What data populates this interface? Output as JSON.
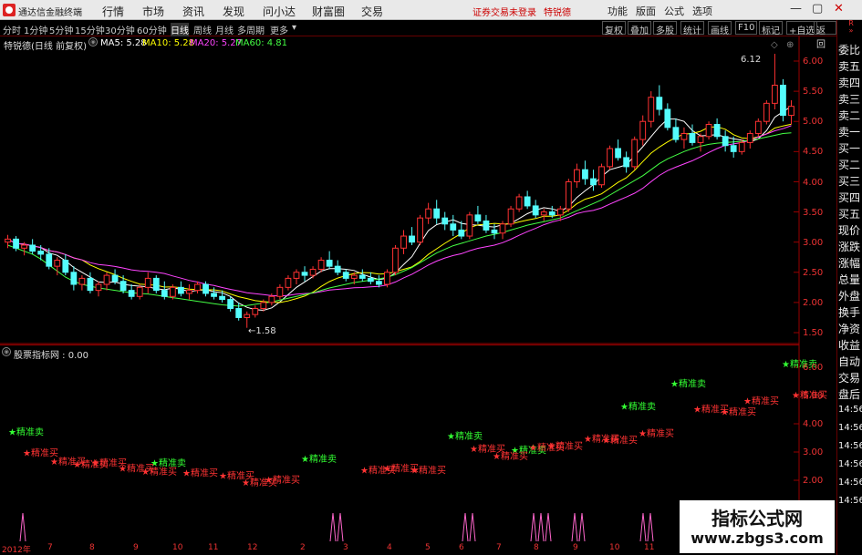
{
  "menubar": {
    "app_title": "通达信金融终端",
    "menus": [
      "行情",
      "市场",
      "资讯",
      "发现",
      "问小达",
      "财富圈",
      "交易"
    ],
    "notice_left": "证券交易未登录",
    "notice_right": "特锐德",
    "right_items": [
      "功能",
      "版面",
      "公式",
      "选项"
    ],
    "window_buttons": [
      "—",
      "▢",
      "✕"
    ]
  },
  "toolbar": {
    "periods": [
      "分时",
      "1分钟",
      "5分钟",
      "15分钟",
      "30分钟",
      "60分钟",
      "日线",
      "周线",
      "月线",
      "多周期",
      "更多"
    ],
    "selected_period": "日线",
    "right_buttons": [
      "复权",
      "叠加",
      "多股",
      "统计",
      "画线",
      "F10",
      "标记",
      "+自选",
      "返回"
    ]
  },
  "main_chart": {
    "legend_name": "特锐德(日线 前复权)",
    "ma": [
      {
        "label": "MA5: 5.28",
        "color": "#ffffff"
      },
      {
        "label": "MA10: 5.28",
        "color": "#ffff00"
      },
      {
        "label": "MA20: 5.27",
        "color": "#ff44ff"
      },
      {
        "label": "MA60: 4.81",
        "color": "#44ff44"
      }
    ],
    "max_label": "6.12",
    "min_label": "←1.58",
    "price_axis": [
      "6.00",
      "5.50",
      "5.00",
      "4.50",
      "4.00",
      "3.50",
      "3.00",
      "2.50",
      "2.00",
      "1.50"
    ]
  },
  "indicator": {
    "legend": "股票指标网 : 0.00",
    "axis": [
      "6.00",
      "5.00",
      "4.00",
      "3.00",
      "2.00"
    ],
    "sell_label": "精准卖",
    "buy_label": "精准买"
  },
  "date_axis": [
    "2012年",
    "7",
    "8",
    "9",
    "10",
    "11",
    "12",
    "2",
    "3",
    "4",
    "5",
    "6",
    "7",
    "8",
    "9",
    "10",
    "11",
    "12"
  ],
  "right_panel": [
    "委比",
    "卖五",
    "卖四",
    "卖三",
    "卖二",
    "卖一",
    "买一",
    "买二",
    "买三",
    "买四",
    "买五",
    "现价",
    "涨跌",
    "涨幅",
    "总量",
    "外盘",
    "换手",
    "净资",
    "收益",
    "自动",
    "交易",
    "盘后",
    "14:56",
    "14:56",
    "14:56",
    "14:56",
    "14:56",
    "14:56"
  ],
  "watermark": {
    "title": "指标公式网",
    "url": "www.zbgs3.com"
  },
  "chart_data": {
    "type": "candlestick",
    "candles": [
      [
        3.0,
        3.12,
        2.9,
        3.05
      ],
      [
        3.05,
        3.1,
        2.85,
        2.9
      ],
      [
        2.9,
        3.0,
        2.78,
        2.95
      ],
      [
        2.95,
        3.05,
        2.8,
        2.85
      ],
      [
        2.85,
        2.95,
        2.7,
        2.8
      ],
      [
        2.8,
        2.9,
        2.55,
        2.6
      ],
      [
        2.6,
        2.75,
        2.45,
        2.7
      ],
      [
        2.7,
        2.8,
        2.45,
        2.5
      ],
      [
        2.5,
        2.6,
        2.2,
        2.3
      ],
      [
        2.3,
        2.45,
        2.2,
        2.4
      ],
      [
        2.4,
        2.5,
        2.15,
        2.2
      ],
      [
        2.2,
        2.35,
        2.1,
        2.3
      ],
      [
        2.3,
        2.5,
        2.2,
        2.45
      ],
      [
        2.45,
        2.55,
        2.3,
        2.35
      ],
      [
        2.35,
        2.45,
        2.15,
        2.2
      ],
      [
        2.2,
        2.3,
        2.05,
        2.1
      ],
      [
        2.1,
        2.3,
        2.05,
        2.25
      ],
      [
        2.25,
        2.5,
        2.15,
        2.4
      ],
      [
        2.4,
        2.45,
        2.15,
        2.2
      ],
      [
        2.2,
        2.35,
        2.05,
        2.1
      ],
      [
        2.1,
        2.3,
        2.05,
        2.25
      ],
      [
        2.25,
        2.35,
        2.1,
        2.15
      ],
      [
        2.15,
        2.3,
        2.05,
        2.2
      ],
      [
        2.2,
        2.35,
        2.15,
        2.3
      ],
      [
        2.3,
        2.35,
        2.1,
        2.15
      ],
      [
        2.15,
        2.25,
        2.05,
        2.1
      ],
      [
        2.1,
        2.2,
        2.0,
        2.05
      ],
      [
        2.05,
        2.1,
        1.85,
        1.9
      ],
      [
        1.9,
        2.0,
        1.7,
        1.75
      ],
      [
        1.75,
        1.85,
        1.58,
        1.8
      ],
      [
        1.8,
        1.95,
        1.75,
        1.9
      ],
      [
        1.9,
        2.05,
        1.85,
        2.0
      ],
      [
        2.0,
        2.15,
        1.95,
        2.1
      ],
      [
        2.1,
        2.3,
        2.05,
        2.25
      ],
      [
        2.25,
        2.45,
        2.2,
        2.4
      ],
      [
        2.4,
        2.55,
        2.3,
        2.5
      ],
      [
        2.5,
        2.6,
        2.35,
        2.45
      ],
      [
        2.45,
        2.6,
        2.4,
        2.55
      ],
      [
        2.55,
        2.75,
        2.5,
        2.7
      ],
      [
        2.7,
        2.85,
        2.55,
        2.6
      ],
      [
        2.6,
        2.7,
        2.45,
        2.5
      ],
      [
        2.5,
        2.55,
        2.35,
        2.4
      ],
      [
        2.4,
        2.5,
        2.3,
        2.45
      ],
      [
        2.45,
        2.55,
        2.35,
        2.4
      ],
      [
        2.4,
        2.5,
        2.3,
        2.35
      ],
      [
        2.35,
        2.45,
        2.25,
        2.3
      ],
      [
        2.3,
        2.55,
        2.25,
        2.5
      ],
      [
        2.5,
        2.95,
        2.45,
        2.9
      ],
      [
        2.9,
        3.2,
        2.8,
        3.1
      ],
      [
        3.1,
        3.25,
        2.95,
        3.0
      ],
      [
        3.0,
        3.45,
        2.95,
        3.4
      ],
      [
        3.4,
        3.65,
        3.3,
        3.55
      ],
      [
        3.55,
        3.7,
        3.3,
        3.4
      ],
      [
        3.4,
        3.5,
        3.2,
        3.3
      ],
      [
        3.3,
        3.45,
        3.1,
        3.2
      ],
      [
        3.2,
        3.35,
        3.05,
        3.1
      ],
      [
        3.1,
        3.5,
        3.05,
        3.45
      ],
      [
        3.45,
        3.6,
        3.3,
        3.35
      ],
      [
        3.35,
        3.45,
        3.15,
        3.2
      ],
      [
        3.2,
        3.3,
        3.05,
        3.15
      ],
      [
        3.15,
        3.35,
        3.05,
        3.3
      ],
      [
        3.3,
        3.6,
        3.25,
        3.55
      ],
      [
        3.55,
        3.8,
        3.5,
        3.75
      ],
      [
        3.75,
        3.85,
        3.55,
        3.6
      ],
      [
        3.6,
        3.7,
        3.4,
        3.45
      ],
      [
        3.45,
        3.55,
        3.35,
        3.5
      ],
      [
        3.5,
        3.6,
        3.4,
        3.45
      ],
      [
        3.45,
        3.6,
        3.35,
        3.55
      ],
      [
        3.55,
        4.05,
        3.5,
        4.0
      ],
      [
        4.0,
        4.3,
        3.9,
        4.2
      ],
      [
        4.2,
        4.35,
        3.95,
        4.05
      ],
      [
        4.05,
        4.2,
        3.85,
        3.95
      ],
      [
        3.95,
        4.3,
        3.9,
        4.25
      ],
      [
        4.25,
        4.6,
        4.2,
        4.55
      ],
      [
        4.55,
        4.7,
        4.35,
        4.4
      ],
      [
        4.4,
        4.5,
        4.15,
        4.25
      ],
      [
        4.25,
        4.75,
        4.2,
        4.7
      ],
      [
        4.7,
        5.1,
        4.6,
        5.0
      ],
      [
        5.0,
        5.5,
        4.9,
        5.4
      ],
      [
        5.4,
        5.6,
        5.1,
        5.2
      ],
      [
        5.2,
        5.3,
        4.85,
        4.9
      ],
      [
        4.9,
        5.05,
        4.65,
        4.7
      ],
      [
        4.7,
        4.9,
        4.55,
        4.8
      ],
      [
        4.8,
        4.95,
        4.6,
        4.65
      ],
      [
        4.65,
        4.8,
        4.5,
        4.75
      ],
      [
        4.75,
        5.0,
        4.7,
        4.95
      ],
      [
        4.95,
        5.05,
        4.7,
        4.75
      ],
      [
        4.75,
        4.85,
        4.5,
        4.6
      ],
      [
        4.6,
        4.75,
        4.4,
        4.5
      ],
      [
        4.5,
        4.7,
        4.45,
        4.65
      ],
      [
        4.65,
        4.85,
        4.55,
        4.8
      ],
      [
        4.8,
        5.05,
        4.75,
        5.0
      ],
      [
        5.0,
        5.35,
        4.95,
        5.3
      ],
      [
        5.3,
        6.12,
        5.2,
        5.6
      ],
      [
        5.6,
        5.7,
        5.0,
        5.1
      ],
      [
        5.1,
        5.35,
        4.95,
        5.25
      ]
    ],
    "ma60": [
      2.95,
      2.9,
      2.85,
      2.8,
      2.72,
      2.62,
      2.52,
      2.42,
      2.35,
      2.3,
      2.27,
      2.24,
      2.22,
      2.2,
      2.18,
      2.16,
      2.15,
      2.14,
      2.12,
      2.1,
      2.08,
      2.06,
      2.04,
      2.02,
      2.0,
      1.98,
      1.96,
      1.95,
      1.94,
      1.95,
      1.97,
      1.99,
      2.01,
      2.04,
      2.07,
      2.1,
      2.13,
      2.16,
      2.2,
      2.24,
      2.27,
      2.3,
      2.33,
      2.35,
      2.37,
      2.39,
      2.42,
      2.46,
      2.52,
      2.58,
      2.66,
      2.74,
      2.82,
      2.88,
      2.94,
      2.98,
      3.02,
      3.06,
      3.1,
      3.13,
      3.16,
      3.2,
      3.24,
      3.28,
      3.31,
      3.34,
      3.37,
      3.4,
      3.46,
      3.52,
      3.58,
      3.64,
      3.7,
      3.78,
      3.86,
      3.94,
      4.02,
      4.1,
      4.2,
      4.3,
      4.38,
      4.44,
      4.5,
      4.55,
      4.59,
      4.62,
      4.64,
      4.65,
      4.66,
      4.67,
      4.69,
      4.71,
      4.74,
      4.77,
      4.8,
      4.81
    ],
    "sell_signals": [
      [
        9,
        3.6
      ],
      [
        165,
        2.5
      ],
      [
        330,
        2.65
      ],
      [
        490,
        3.45
      ],
      [
        560,
        2.95
      ],
      [
        680,
        4.5
      ],
      [
        735,
        5.3
      ],
      [
        857,
        6.0
      ]
    ],
    "buy_signals": [
      [
        25,
        2.85
      ],
      [
        55,
        2.55
      ],
      [
        80,
        2.45
      ],
      [
        100,
        2.5
      ],
      [
        130,
        2.3
      ],
      [
        155,
        2.2
      ],
      [
        200,
        2.15
      ],
      [
        240,
        2.05
      ],
      [
        265,
        1.8
      ],
      [
        290,
        1.9
      ],
      [
        395,
        2.25
      ],
      [
        420,
        2.3
      ],
      [
        450,
        2.25
      ],
      [
        515,
        3.0
      ],
      [
        540,
        2.75
      ],
      [
        580,
        3.05
      ],
      [
        600,
        3.1
      ],
      [
        640,
        3.35
      ],
      [
        660,
        3.3
      ],
      [
        700,
        3.55
      ],
      [
        760,
        4.4
      ],
      [
        790,
        4.3
      ],
      [
        815,
        4.7
      ],
      [
        868,
        4.9
      ]
    ],
    "signal_spikes": [
      [
        25,
        1
      ],
      [
        365,
        2
      ],
      [
        510,
        2
      ],
      [
        585,
        3
      ],
      [
        630,
        2
      ],
      [
        705,
        2
      ]
    ]
  }
}
